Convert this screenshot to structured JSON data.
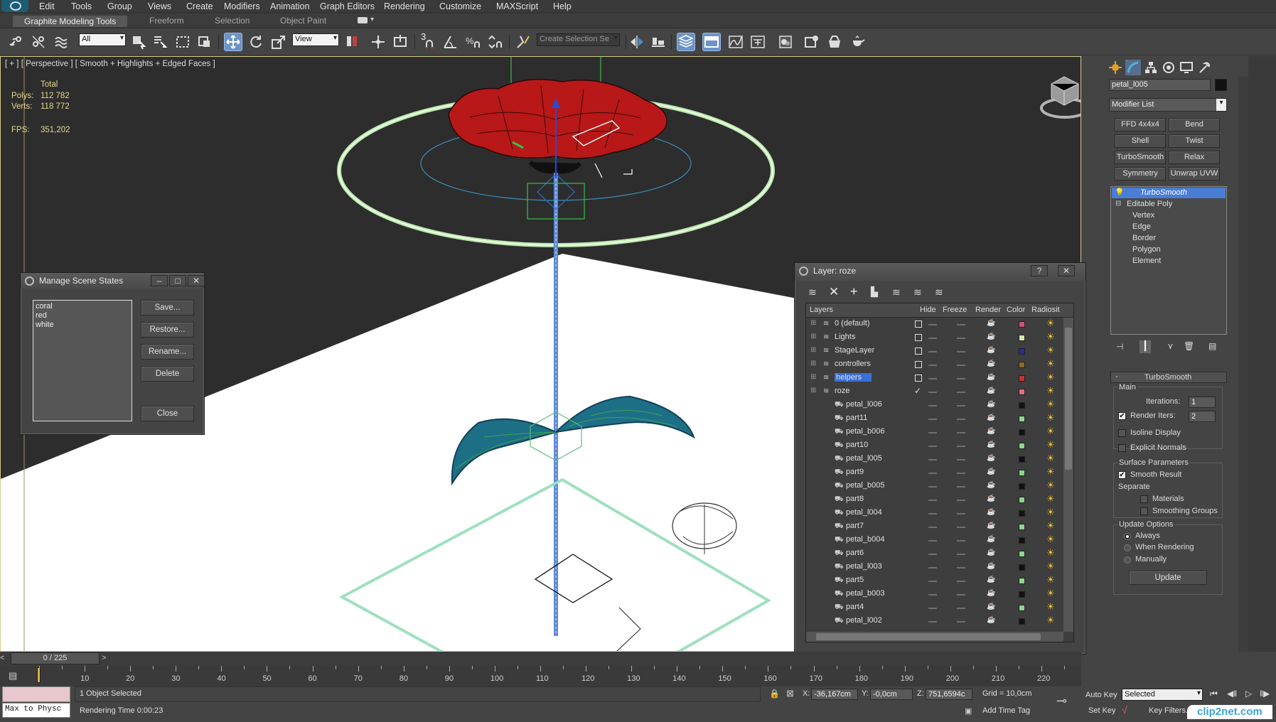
{
  "menu": [
    "Edit",
    "Tools",
    "Group",
    "Views",
    "Create",
    "Modifiers",
    "Animation",
    "Graph Editors",
    "Rendering",
    "Customize",
    "MAXScript",
    "Help"
  ],
  "ribbon": {
    "tabs": [
      "Graphite Modeling Tools",
      "Freeform",
      "Selection",
      "Object Paint"
    ],
    "active": "Graphite Modeling Tools"
  },
  "toolbar": {
    "selection_filter": "All",
    "ref_coord": "View",
    "named_selection_placeholder": "Create Selection Se",
    "snap_count": "3",
    "icons": [
      "link-icon",
      "unlink-icon",
      "bind-space-warp-icon",
      "select-object-icon",
      "select-by-name-icon",
      "rect-region-icon",
      "window-crossing-icon",
      "move-icon",
      "rotate-icon",
      "scale-icon",
      "pivot-icon",
      "manipulate-icon",
      "keyboard-shortcut-icon",
      "snap-3d-icon",
      "angle-snap-icon",
      "percent-snap-icon",
      "spinner-snap-icon",
      "edit-named-selections-icon",
      "mirror-icon",
      "align-icon",
      "layer-manager-icon",
      "graphite-toggle-icon",
      "curve-editor-icon",
      "schematic-view-icon",
      "material-editor-icon",
      "render-setup-icon",
      "rendered-frame-icon",
      "render-icon"
    ]
  },
  "viewport": {
    "label": "[ + ] [ Perspective ] [ Smooth + Highlights + Edged Faces ]",
    "stats": {
      "total_label": "Total",
      "polys_label": "Polys:",
      "polys": "112 782",
      "verts_label": "Verts:",
      "verts": "118 772",
      "fps_label": "FPS:",
      "fps": "351,202"
    }
  },
  "scene_states": {
    "title": "Manage Scene States",
    "items": [
      "coral",
      "red",
      "white"
    ],
    "buttons": {
      "save": "Save...",
      "restore": "Restore...",
      "rename": "Rename...",
      "delete": "Delete",
      "close": "Close"
    }
  },
  "layer_dialog": {
    "title": "Layer: roze",
    "columns": [
      "Layers",
      "Hide",
      "Freeze",
      "Render",
      "Color",
      "Radiosit"
    ],
    "rows": [
      {
        "name": "0 (default)",
        "type": "layer",
        "color": "#d2507a"
      },
      {
        "name": "Lights",
        "type": "layer",
        "color": "#d8e8a8"
      },
      {
        "name": "StageLayer",
        "type": "layer",
        "color": "#2a2a9a"
      },
      {
        "name": "controllers",
        "type": "layer",
        "color": "#8a6a2a"
      },
      {
        "name": "helpers",
        "type": "layer",
        "color": "#c83030",
        "selected": true
      },
      {
        "name": "roze",
        "type": "layer",
        "color": "#e07080",
        "current": true
      },
      {
        "name": "petal_l006",
        "type": "object",
        "color": "#111111"
      },
      {
        "name": "part11",
        "type": "object",
        "color": "#8ad88a"
      },
      {
        "name": "petal_b006",
        "type": "object",
        "color": "#111111"
      },
      {
        "name": "part10",
        "type": "object",
        "color": "#8ad88a"
      },
      {
        "name": "petal_l005",
        "type": "object",
        "color": "#111111"
      },
      {
        "name": "part9",
        "type": "object",
        "color": "#8ad88a"
      },
      {
        "name": "petal_b005",
        "type": "object",
        "color": "#111111"
      },
      {
        "name": "part8",
        "type": "object",
        "color": "#8ad88a"
      },
      {
        "name": "petal_l004",
        "type": "object",
        "color": "#111111"
      },
      {
        "name": "part7",
        "type": "object",
        "color": "#8ad88a"
      },
      {
        "name": "petal_b004",
        "type": "object",
        "color": "#111111"
      },
      {
        "name": "part6",
        "type": "object",
        "color": "#8ad88a"
      },
      {
        "name": "petal_l003",
        "type": "object",
        "color": "#111111"
      },
      {
        "name": "part5",
        "type": "object",
        "color": "#8ad88a"
      },
      {
        "name": "petal_b003",
        "type": "object",
        "color": "#111111"
      },
      {
        "name": "part4",
        "type": "object",
        "color": "#8ad88a"
      },
      {
        "name": "petal_l002",
        "type": "object",
        "color": "#111111"
      }
    ]
  },
  "command_panel": {
    "object_name": "petal_l005",
    "object_color": "#111111",
    "modifier_list": "Modifier List",
    "mod_buttons": [
      "FFD 4x4x4",
      "Bend",
      "Shell",
      "Twist",
      "TurboSmooth",
      "Relax",
      "Symmetry",
      "Unwrap UVW"
    ],
    "stack": [
      "TurboSmooth",
      "Editable Poly",
      "Vertex",
      "Edge",
      "Border",
      "Polygon",
      "Element"
    ],
    "rollout": {
      "title": "TurboSmooth",
      "main": "Main",
      "iterations_label": "Iterations:",
      "iterations": "1",
      "render_iters_label": "Render Iters:",
      "render_iters": "2",
      "render_iters_checked": true,
      "isoline": "Isoline Display",
      "explicit_normals": "Explicit Normals",
      "surface_params": "Surface Parameters",
      "smooth_result": "Smooth Result",
      "separate": "Separate",
      "materials": "Materials",
      "smoothing_groups": "Smoothing Groups",
      "update_options": "Update Options",
      "always": "Always",
      "when_rendering": "When Rendering",
      "manually": "Manually",
      "update_button": "Update"
    }
  },
  "timeline": {
    "frame": "0 / 225",
    "ticks": [
      "10",
      "20",
      "30",
      "40",
      "50",
      "60",
      "70",
      "80",
      "90",
      "100",
      "110",
      "120",
      "130",
      "140",
      "150",
      "160",
      "170",
      "180",
      "190",
      "200",
      "210",
      "220"
    ]
  },
  "status": {
    "maxscript": "Max to Physc",
    "selected": "1 Object Selected",
    "rendering_time": "Rendering Time  0:00:23",
    "x_label": "X:",
    "x": "-36,167cm",
    "y_label": "Y:",
    "y": "-0,0cm",
    "z_label": "Z:",
    "z": "751,6594c",
    "grid": "Grid = 10,0cm",
    "add_time_tag": "Add Time Tag",
    "auto_key": "Auto Key",
    "set_key": "Set Key",
    "key_mode": "Selected",
    "key_filters": "Key Filters...",
    "watermark": "clip2net.com"
  }
}
